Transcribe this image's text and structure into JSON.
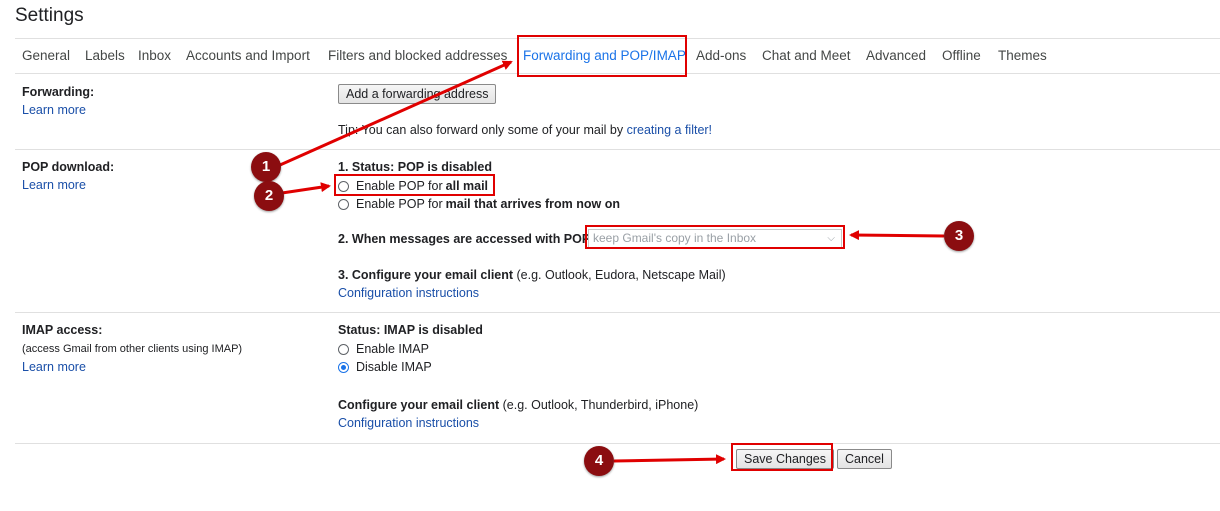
{
  "page_title": "Settings",
  "tabs": [
    {
      "label": "General"
    },
    {
      "label": "Labels"
    },
    {
      "label": "Inbox"
    },
    {
      "label": "Accounts and Import"
    },
    {
      "label": "Filters and blocked addresses"
    },
    {
      "label": "Forwarding and POP/IMAP"
    },
    {
      "label": "Add-ons"
    },
    {
      "label": "Chat and Meet"
    },
    {
      "label": "Advanced"
    },
    {
      "label": "Offline"
    },
    {
      "label": "Themes"
    }
  ],
  "forwarding": {
    "label": "Forwarding:",
    "learn_more": "Learn more",
    "add_button": "Add a forwarding address",
    "tip_prefix": "Tip: You can also forward only some of your mail by ",
    "tip_link": "creating a filter!"
  },
  "pop": {
    "label": "POP download:",
    "learn_more": "Learn more",
    "status": "1. Status: POP is disabled",
    "option1_prefix": "Enable POP for ",
    "option1_bold": "all mail",
    "option2_prefix": "Enable POP for ",
    "option2_bold": "mail that arrives from now on",
    "step2_label": "2. When messages are accessed with POP",
    "step2_select_value": "keep Gmail's copy in the Inbox",
    "step3_label": "3. Configure your email client",
    "step3_note": " (e.g. Outlook, Eudora, Netscape Mail)",
    "config_link": "Configuration instructions"
  },
  "imap": {
    "label": "IMAP access:",
    "sub": "(access Gmail from other clients using IMAP)",
    "learn_more": "Learn more",
    "status": "Status: IMAP is disabled",
    "enable": "Enable IMAP",
    "disable": "Disable IMAP",
    "selected": "disable",
    "configure_label": "Configure your email client",
    "configure_note": " (e.g. Outlook, Thunderbird, iPhone)",
    "config_link": "Configuration instructions"
  },
  "actions": {
    "save": "Save Changes",
    "cancel": "Cancel"
  },
  "annotations": {
    "color": "#e00000",
    "marker_color": "#8b0d10",
    "markers": [
      "1",
      "2",
      "3",
      "4"
    ]
  }
}
